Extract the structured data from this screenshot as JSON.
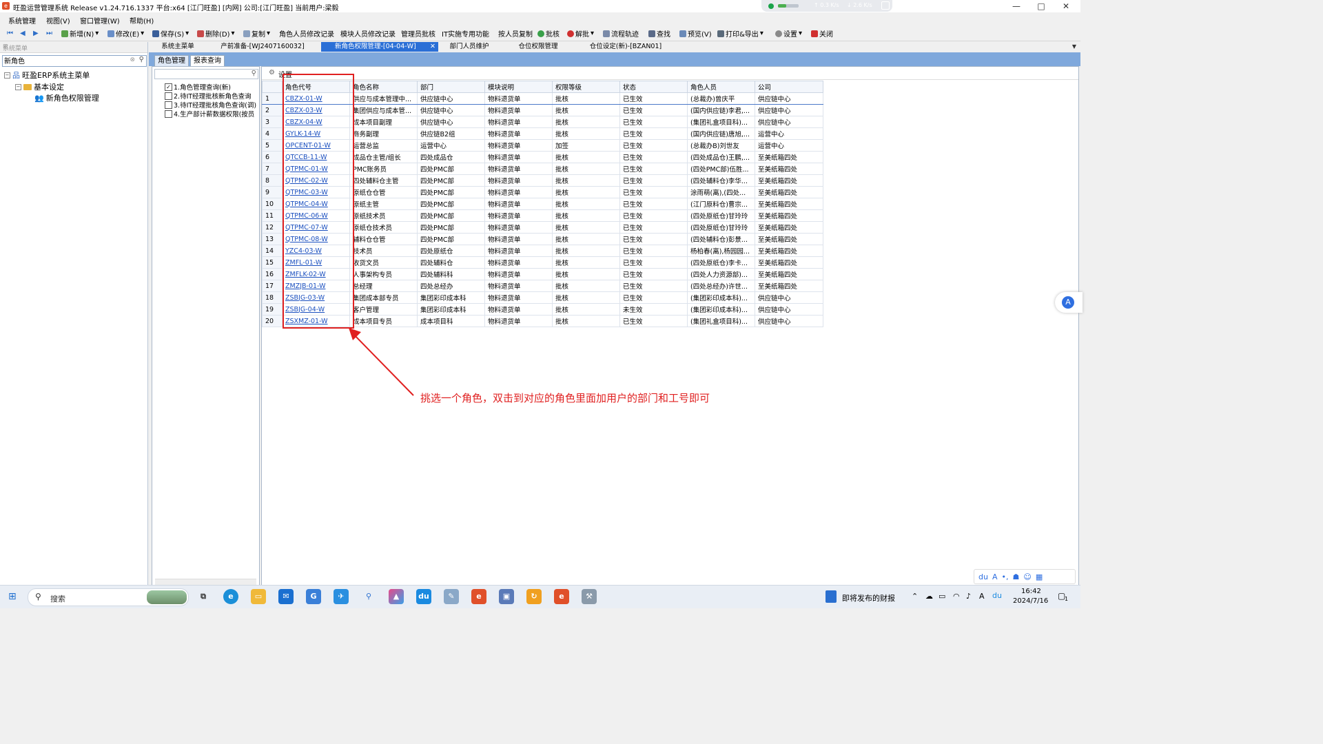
{
  "window": {
    "title": "旺盈运营管理系统 Release v1.24.716.1337 平台:x64  [江门旺盈] [内网] 公司:[江门旺盈] 当前用户:梁毅",
    "app_icon": "erp-logo-icon",
    "minimize": "—",
    "maximize": "□",
    "close": "✕"
  },
  "network_widget": {
    "up": "↑ 0.3  K/s",
    "down": "↓ 2.6  K/s",
    "cpu_fill_percent": 40
  },
  "menubar": [
    "系统管理",
    "视图(V)",
    "窗口管理(W)",
    "帮助(H)"
  ],
  "toolbar": {
    "new": "新增(N)",
    "edit": "修改(E)",
    "save": "保存(S)",
    "delete": "删除(D)",
    "copy": "复制",
    "role_log": "角色人员修改记录",
    "module_log": "模块人员修改记录",
    "admin_approve": "管理员批核",
    "it_func": "IT实施专用功能",
    "person_copy": "按人员复制",
    "approve": "批核",
    "unapprove": "解批",
    "flow": "流程轨迹",
    "find": "查找",
    "preview": "预览(V)",
    "print": "打印&导出",
    "settings": "设置",
    "close": "关闭"
  },
  "left_panel": {
    "header": "系统菜单",
    "pin": "⊞",
    "search_value": "新角色",
    "tree": {
      "root": "旺盈ERP系统主菜单",
      "folder": "基本设定",
      "leaf": "新角色权限管理"
    }
  },
  "doc_tabs": [
    "系统主菜单",
    "产前准备-[WJ2407160032]",
    "新角色权限管理-[04-04-W]",
    "部门人员维护",
    "仓位权限管理",
    "仓位设定(新)-[BZAN01]"
  ],
  "sub_tabs": [
    "角色管理",
    "报表查询"
  ],
  "query_items": [
    {
      "label": "1.角色管理查询(新)",
      "checked": true
    },
    {
      "label": "2.待IT经理批核新角色查询",
      "checked": false
    },
    {
      "label": "3.待IT经理批核角色查询(调)",
      "checked": false
    },
    {
      "label": "4.生产部计薪数据权限(按员",
      "checked": false
    }
  ],
  "grid": {
    "settings_label": "设置",
    "columns": [
      "角色代号",
      "角色名称",
      "部门",
      "模块说明",
      "权限等级",
      "状态",
      "角色人员",
      "公司"
    ],
    "rows": [
      [
        "1",
        "CBZX-01-W",
        "供应与成本管理中...",
        "供应链中心",
        "物料退货单",
        "批核",
        "已生效",
        "(总裁办)曾庆平",
        "供应链中心"
      ],
      [
        "2",
        "CBZX-03-W",
        "集团供应与成本管...",
        "供应链中心",
        "物料退货单",
        "批核",
        "已生效",
        "(国内供应链)李君,...",
        "供应链中心"
      ],
      [
        "3",
        "CBZX-04-W",
        "成本项目副理",
        "供应链中心",
        "物料退货单",
        "批核",
        "已生效",
        "(集团礼盒项目科)...",
        "供应链中心"
      ],
      [
        "4",
        "GYLK-14-W",
        "商务副理",
        "供应链B2组",
        "物料退货单",
        "批核",
        "已生效",
        "(国内供应链)唐旭,...",
        "运营中心"
      ],
      [
        "5",
        "OPCENT-01-W",
        "运营总监",
        "运营中心",
        "物料退货单",
        "加签",
        "已生效",
        "(总裁办B)刘世友",
        "运营中心"
      ],
      [
        "6",
        "QTCCB-11-W",
        "成品仓主管/组长",
        "四处成品仓",
        "物料退货单",
        "批核",
        "已生效",
        "(四处成品仓)王鹏,...",
        "至美纸箱四处"
      ],
      [
        "7",
        "QTPMC-01-W",
        "PMC账务员",
        "四处PMC部",
        "物料退货单",
        "批核",
        "已生效",
        "(四处PMC部)伍胜...",
        "至美纸箱四处"
      ],
      [
        "8",
        "QTPMC-02-W",
        "四处辅料仓主管",
        "四处PMC部",
        "物料退货单",
        "批核",
        "已生效",
        "(四处辅料仓)李华...",
        "至美纸箱四处"
      ],
      [
        "9",
        "QTPMC-03-W",
        "原纸仓仓管",
        "四处PMC部",
        "物料退货单",
        "批核",
        "已生效",
        "涂雨萌(离),(四处...",
        "至美纸箱四处"
      ],
      [
        "10",
        "QTPMC-04-W",
        "原纸主管",
        "四处PMC部",
        "物料退货单",
        "批核",
        "已生效",
        "(江门原料仓)曹宗...",
        "至美纸箱四处"
      ],
      [
        "11",
        "QTPMC-06-W",
        "原纸技术员",
        "四处PMC部",
        "物料退货单",
        "批核",
        "已生效",
        "(四处原纸仓)甘玲玲",
        "至美纸箱四处"
      ],
      [
        "12",
        "QTPMC-07-W",
        "原纸仓技术员",
        "四处PMC部",
        "物料退货单",
        "批核",
        "已生效",
        "(四处原纸仓)甘玲玲",
        "至美纸箱四处"
      ],
      [
        "13",
        "QTPMC-08-W",
        "辅料仓仓管",
        "四处PMC部",
        "物料退货单",
        "批核",
        "已生效",
        "(四处辅料仓)彭景...",
        "至美纸箱四处"
      ],
      [
        "14",
        "YZC4-03-W",
        "技术员",
        "四处原纸仓",
        "物料退货单",
        "批核",
        "已生效",
        "杨柏春(离),杨园园...",
        "至美纸箱四处"
      ],
      [
        "15",
        "ZMFL-01-W",
        "收货文员",
        "四处辅料仓",
        "物料退货单",
        "批核",
        "已生效",
        "(四处原纸仓)李卡...",
        "至美纸箱四处"
      ],
      [
        "16",
        "ZMFLK-02-W",
        "人事架构专员",
        "四处辅料科",
        "物料退货单",
        "批核",
        "已生效",
        "(四处人力资源部)...",
        "至美纸箱四处"
      ],
      [
        "17",
        "ZMZJB-01-W",
        "总经理",
        "四处总经办",
        "物料退货单",
        "批核",
        "已生效",
        "(四处总经办)许世...",
        "至美纸箱四处"
      ],
      [
        "18",
        "ZSBJG-03-W",
        "集团成本部专员",
        "集团彩印成本科",
        "物料退货单",
        "批核",
        "已生效",
        "(集团彩印成本科)...",
        "供应链中心"
      ],
      [
        "19",
        "ZSBJG-04-W",
        "客户管理",
        "集团彩印成本科",
        "物料退货单",
        "批核",
        "未生效",
        "(集团彩印成本科)...",
        "供应链中心"
      ],
      [
        "20",
        "ZSXMZ-01-W",
        "成本项目专员",
        "成本项目科",
        "物料退货单",
        "批核",
        "已生效",
        "(集团礼盒项目科)...",
        "供应链中心"
      ]
    ]
  },
  "annotation": {
    "text": "挑选一个角色，双击到对应的角色里面加用户的部门和工号即可",
    "color": "#e02020"
  },
  "taskbar": {
    "search_placeholder": "搜索",
    "news": "即将发布的财报",
    "time": "16:42",
    "date": "2024/7/16",
    "notif_count": "1",
    "ime": "A"
  },
  "colors": {
    "active_tab": "#2b6fd6",
    "band": "#7fa8dc",
    "link": "#1a4fbf"
  }
}
